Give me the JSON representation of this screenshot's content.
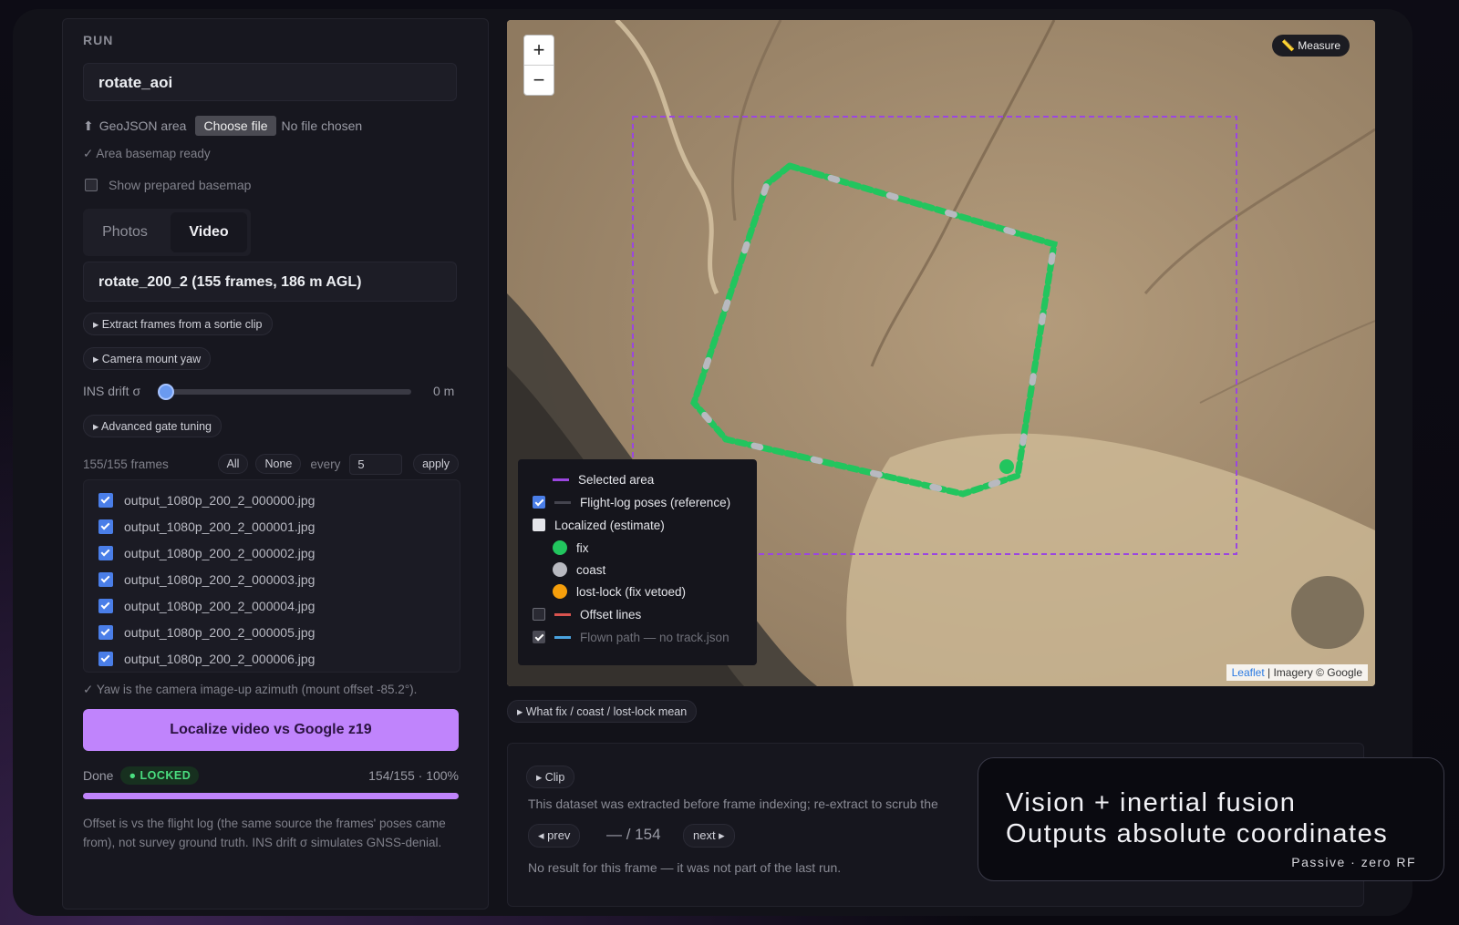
{
  "run": {
    "section_title": "RUN",
    "name_value": "rotate_aoi",
    "geojson_label": "GeoJSON area",
    "choose_file_label": "Choose file",
    "no_file_label": "No file chosen",
    "basemap_ready": "✓ Area basemap ready",
    "show_basemap_label": "Show prepared basemap",
    "tabs": [
      "Photos",
      "Video"
    ],
    "active_tab": "Video",
    "video_value": "rotate_200_2 (155 frames, 186 m AGL)",
    "extract_label": "▸ Extract frames from a sortie clip",
    "mount_yaw_label": "▸ Camera mount yaw",
    "ins_drift_label": "INS drift σ",
    "ins_drift_value": "0 m",
    "ins_drift_fraction": 0,
    "advanced_label": "▸ Advanced gate tuning",
    "frames_count": "155/155 frames",
    "all_label": "All",
    "none_label": "None",
    "every_label": "every",
    "every_value": "5",
    "apply_label": "apply",
    "files": [
      "output_1080p_200_2_000000.jpg",
      "output_1080p_200_2_000001.jpg",
      "output_1080p_200_2_000002.jpg",
      "output_1080p_200_2_000003.jpg",
      "output_1080p_200_2_000004.jpg",
      "output_1080p_200_2_000005.jpg",
      "output_1080p_200_2_000006.jpg"
    ],
    "yaw_note": "✓ Yaw is the camera image-up azimuth (mount offset -85.2°).",
    "localize_button": "Localize video vs Google z19",
    "done_label": "Done",
    "locked_badge": "● LOCKED",
    "progress_text": "154/155 · 100%",
    "progress_fraction": 1.0,
    "offset_note": "Offset is vs the flight log (the same source the frames' poses came from), not survey ground truth. INS drift σ simulates GNSS-denial."
  },
  "map": {
    "zoom_in": "+",
    "zoom_out": "−",
    "measure_label": "📏 Measure",
    "attribution_leaflet": "Leaflet",
    "attribution_rest": " | Imagery © Google",
    "colors": {
      "area": "#9b46e0",
      "fix": "#22c55e",
      "coast": "#b8b9c0",
      "lostlock": "#f59e0b",
      "offset": "#d9534f",
      "flown": "#4aa3df"
    },
    "legend": {
      "selected_area": "Selected area",
      "flight_log": "Flight-log poses (reference)",
      "localized": "Localized (estimate)",
      "fix": "fix",
      "coast": "coast",
      "lost_lock": "lost-lock (fix vetoed)",
      "offset_lines": "Offset lines",
      "flown_path": "Flown path — no track.json"
    }
  },
  "what_label": "▸ What fix / coast / lost-lock mean",
  "clip": {
    "toggle_label": "▸ Clip",
    "note": "This dataset was extracted before frame indexing; re-extract to scrub the",
    "prev_label": "◂ prev",
    "counter": "— / 154",
    "next_label": "next ▸",
    "no_result": "No result for this frame — it was not part of the last run."
  },
  "caption": {
    "line1": "Vision + inertial fusion",
    "line2": "Outputs absolute coordinates",
    "sub": "Passive · zero RF"
  }
}
